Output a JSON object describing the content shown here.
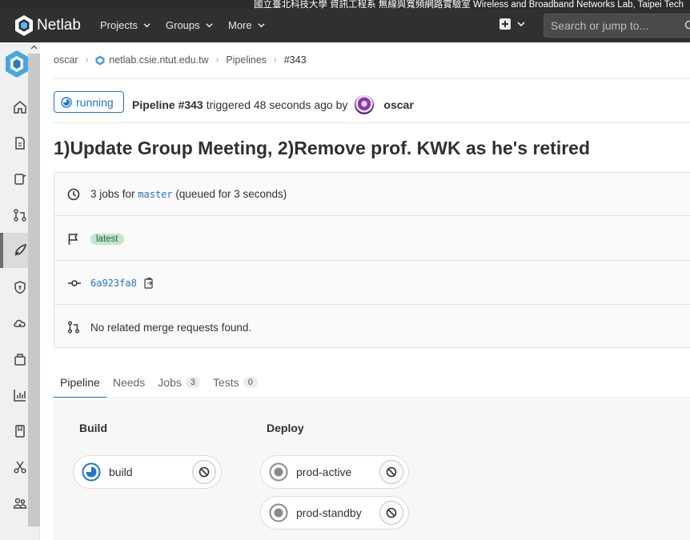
{
  "banner": {
    "text": "國立臺北科技大學 資訊工程系 無線與寬頻網路實驗室 Wireless and Broadband Networks Lab, Taipei Tech"
  },
  "navbar": {
    "logo_text": "Netlab",
    "items": [
      "Projects",
      "Groups",
      "More"
    ],
    "search_placeholder": "Search or jump to..."
  },
  "breadcrumb": [
    "oscar",
    "netlab.csie.ntut.edu.tw",
    "Pipelines",
    "#343"
  ],
  "pipeline": {
    "status": "running",
    "title": "Pipeline #343",
    "triggered_text": "triggered 48 seconds ago by",
    "author": "oscar"
  },
  "commit_title": "1)Update Group Meeting, 2)Remove prof. KWK as he's retired",
  "info": {
    "jobs_prefix": "3 jobs for",
    "branch": "master",
    "jobs_suffix": "(queued for 3 seconds)",
    "badge": "latest",
    "sha": "6a923fa8",
    "merge_text": "No related merge requests found."
  },
  "tabs": [
    {
      "label": "Pipeline",
      "count": null
    },
    {
      "label": "Needs",
      "count": null
    },
    {
      "label": "Jobs",
      "count": "3"
    },
    {
      "label": "Tests",
      "count": "0"
    }
  ],
  "stages": [
    {
      "name": "Build",
      "jobs": [
        {
          "name": "build",
          "status": "running"
        }
      ]
    },
    {
      "name": "Deploy",
      "jobs": [
        {
          "name": "prod-active",
          "status": "created"
        },
        {
          "name": "prod-standby",
          "status": "created"
        }
      ]
    }
  ],
  "colors": {
    "accent": "#1f75cb",
    "navbar": "#303030",
    "success_bg": "#c3e6cd"
  }
}
